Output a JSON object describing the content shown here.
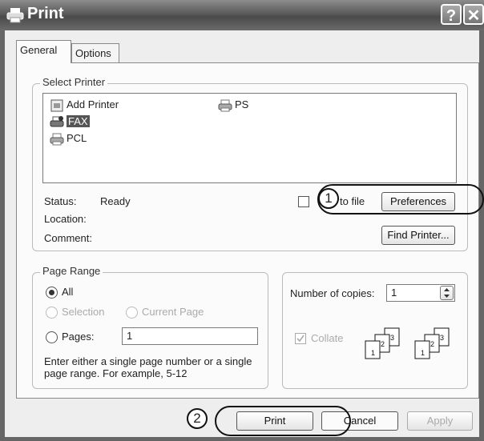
{
  "window": {
    "title": "Print",
    "help_label": "?",
    "close_label": "✕"
  },
  "tabs": [
    {
      "label": "General"
    },
    {
      "label": "Options"
    }
  ],
  "select_printer": {
    "legend": "Select Printer",
    "printers": [
      {
        "name": "Add Printer",
        "icon": "add-printer-icon"
      },
      {
        "name": "PS",
        "icon": "printer-icon"
      },
      {
        "name": "FAX",
        "icon": "fax-printer-icon",
        "selected": true
      },
      {
        "name": "PCL",
        "icon": "printer-icon"
      }
    ],
    "status_label": "Status:",
    "status_value": "Ready",
    "location_label": "Location:",
    "comment_label": "Comment:",
    "print_to_file_label": "to file",
    "preferences_label": "Preferences",
    "find_printer_label": "Find Printer..."
  },
  "page_range": {
    "legend": "Page Range",
    "all_label": "All",
    "selection_label": "Selection",
    "current_page_label": "Current Page",
    "pages_label": "Pages:",
    "pages_value": "1",
    "hint": "Enter either a single page number or a single page range.  For example, 5-12"
  },
  "copies": {
    "number_label": "Number of copies:",
    "number_value": "1",
    "collate_label": "Collate"
  },
  "buttons": {
    "print": "Print",
    "cancel": "Cancel",
    "apply": "Apply"
  },
  "callouts": {
    "one": "1",
    "two": "2"
  }
}
